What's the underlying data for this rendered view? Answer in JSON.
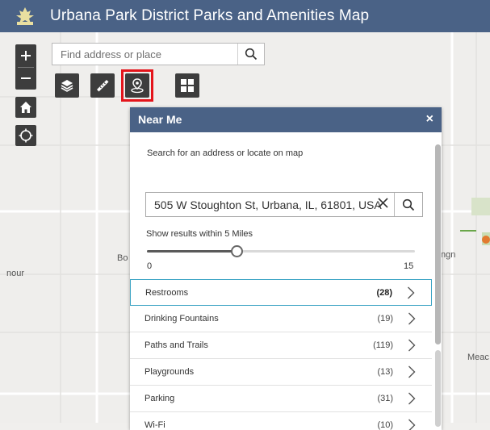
{
  "header": {
    "title": "Urbana Park District Parks and Amenities Map"
  },
  "search": {
    "placeholder": "Find address or place"
  },
  "map": {
    "labels": [
      "Bo",
      "nour",
      "ngn",
      "Meac"
    ]
  },
  "panel": {
    "title": "Near Me",
    "close": "×",
    "search_label": "Search for an address or locate on map",
    "address_value": "505 W Stoughton St, Urbana, IL, 61801, USA",
    "range_label": "Show results within 5 Miles",
    "range_min": "0",
    "range_max": "15",
    "range_value": 5,
    "results": [
      {
        "name": "Restrooms",
        "count": "(28)"
      },
      {
        "name": "Drinking Fountains",
        "count": "(19)"
      },
      {
        "name": "Paths and Trails",
        "count": "(119)"
      },
      {
        "name": "Playgrounds",
        "count": "(13)"
      },
      {
        "name": "Parking",
        "count": "(31)"
      },
      {
        "name": "Wi-Fi",
        "count": "(10)"
      }
    ]
  },
  "colors": {
    "header": "#4a6286",
    "highlight": "#e4141b",
    "selected_border": "#3aa3c4",
    "toolbar": "#3d3d3d"
  },
  "icons": {
    "logo": "park-logo-icon",
    "search": "search-icon",
    "zoom_in": "plus-icon",
    "zoom_out": "minus-icon",
    "home": "home-icon",
    "locate": "locate-icon",
    "layers": "layers-icon",
    "measure": "ruler-icon",
    "near_me": "near-me-icon",
    "basemap": "grid-icon",
    "chevron": "chevron-right-icon",
    "clear": "close-icon"
  }
}
